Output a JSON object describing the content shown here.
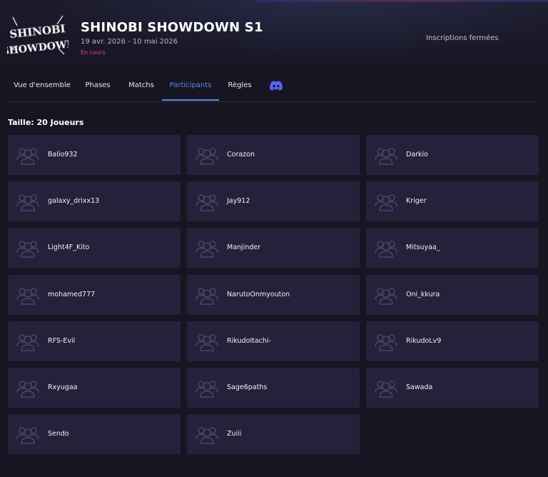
{
  "tournament": {
    "title": "SHINOBI SHOWDOWN S1",
    "dates": "19 avr. 2026 - 10 mai 2026",
    "status": "En cours",
    "registration_status": "Inscriptions fermées",
    "logo_text": [
      "SHINOBI",
      "SHOWDOWN"
    ]
  },
  "tabs": [
    {
      "label": "Vue d'ensemble",
      "active": false
    },
    {
      "label": "Phases",
      "active": false
    },
    {
      "label": "Matchs",
      "active": false
    },
    {
      "label": "Participants",
      "active": true
    },
    {
      "label": "Règles",
      "active": false
    },
    {
      "icon": "discord-icon",
      "active": false
    }
  ],
  "participants": {
    "size_label": "Taille: 20 Joueurs",
    "players": [
      "Balio932",
      "Corazon",
      "Darkio",
      "galaxy_drixx13",
      "Jay912",
      "Kriger",
      "Light4F_Kito",
      "Manjinder",
      "Mitsuyaa_",
      "mohamed777",
      "NarutoOnmyouton",
      "Oni_kkura",
      "RFS-Evil",
      "RikudoItachi-",
      "RikudoLv9",
      "Rxyugaa",
      "Sage6paths",
      "Sawada",
      "Sendo",
      "Zuiii"
    ]
  },
  "colors": {
    "background": "#171522",
    "card": "#24223a",
    "accent": "#4f8fe6",
    "status": "#e0487c",
    "discord": "#5865f2"
  }
}
